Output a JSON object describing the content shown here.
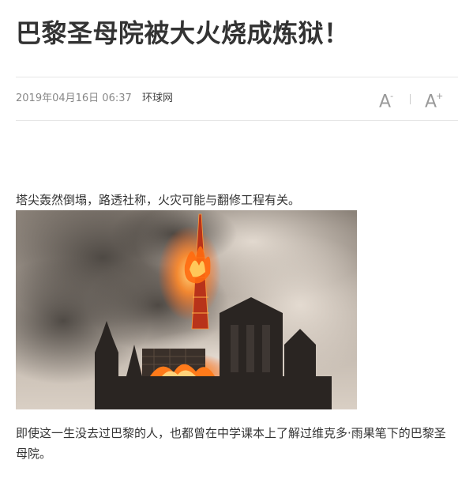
{
  "article": {
    "title": "巴黎圣母院被大火烧成炼狱！",
    "date": "2019年04月16日 06:37",
    "source": "环球网",
    "font_decrease_label": "A",
    "font_decrease_mark": "-",
    "font_increase_label": "A",
    "font_increase_mark": "+",
    "paragraphs": [
      "塔尖轰然倒塌，路透社称，火灾可能与翻修工程有关。",
      "即使这一生没去过巴黎的人，也都曾在中学课本上了解过维克多·雨果笔下的巴黎圣母院。"
    ]
  },
  "photo": {
    "subject": "Notre-Dame cathedral on fire, spire collapsing amid smoke",
    "colors": {
      "smoke_light": "#d8d0c8",
      "smoke_dark": "#5a5550",
      "fire": "#ff7a1a",
      "building": "#2a2522"
    }
  }
}
